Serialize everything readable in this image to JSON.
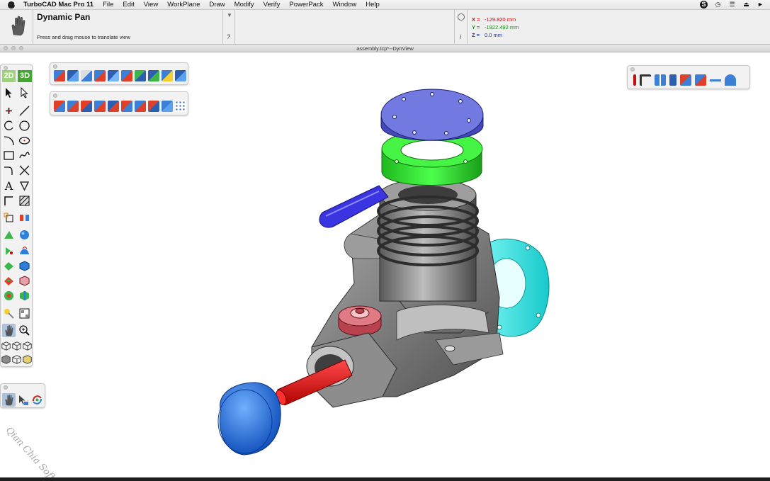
{
  "menubar": {
    "app_name": "TurboCAD Mac Pro 11",
    "items": [
      "File",
      "Edit",
      "View",
      "WorkPlane",
      "Draw",
      "Modify",
      "Verify",
      "PowerPack",
      "Window",
      "Help"
    ],
    "status_icons": [
      "skype-icon",
      "time-machine-icon",
      "wifi-icon",
      "eject-icon",
      "volume-icon"
    ]
  },
  "info": {
    "tool_name": "Dynamic Pan",
    "prompt": "Press and drag mouse to translate view",
    "help_glyph": "?",
    "info_glyph": "i",
    "dropdown_glyph": "▼",
    "x_label": "X =",
    "x_value": "-129.820 mm",
    "y_label": "Y =",
    "y_value": "-1922.492 mm",
    "z_label": "Z =",
    "z_value": "0.0 mm"
  },
  "window": {
    "title": "assembly.tcp*--DynView"
  },
  "toolbar": {
    "mode_2d": "2D",
    "mode_3d": "3D",
    "text_tool": "A"
  },
  "watermark": "Qian Chia Soft",
  "colors": {
    "accent_green": "#46a632",
    "cap_blue": "#4d58c8",
    "ring_green": "#32e632",
    "cylinder_gray": "#8a8a8a",
    "cover_cyan": "#2ce6e6",
    "plug_red": "#c83a48",
    "shaft_red": "#e01010",
    "spinner_blue": "#1a62d8",
    "carb_blue": "#2a2ad2"
  }
}
